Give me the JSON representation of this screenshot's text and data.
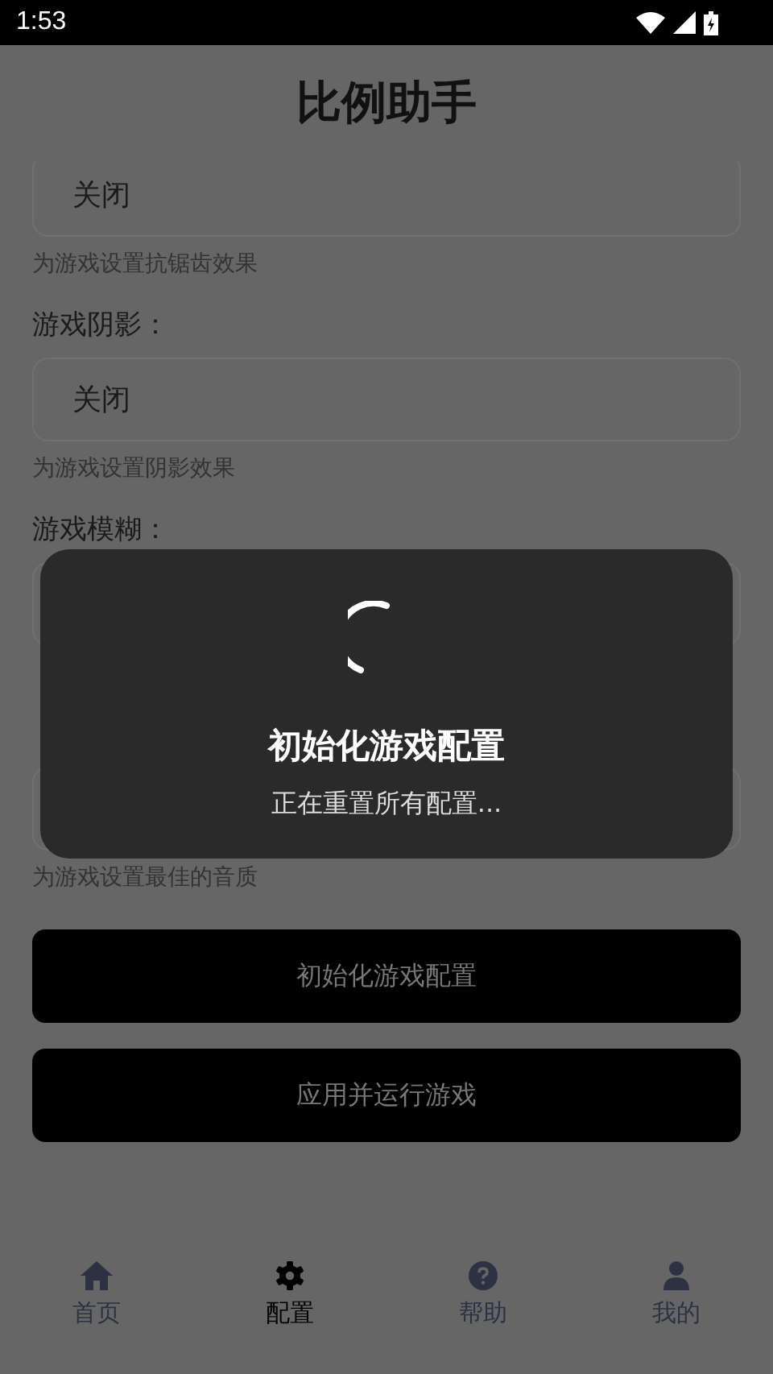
{
  "status_bar": {
    "time": "1:53"
  },
  "header": {
    "title": "比例助手"
  },
  "settings": [
    {
      "value": "关闭",
      "hint": "为游戏设置抗锯齿效果"
    },
    {
      "label": "游戏阴影：",
      "value": "关闭",
      "hint": "为游戏设置阴影效果"
    },
    {
      "label": "游戏模糊："
    },
    {
      "hint": "为游戏设置最佳的音质"
    }
  ],
  "buttons": [
    "初始化游戏配置",
    "应用并运行游戏"
  ],
  "dialog": {
    "title": "初始化游戏配置",
    "message": "正在重置所有配置..."
  },
  "nav": [
    {
      "kind": "home",
      "label": "首页",
      "selected": false
    },
    {
      "kind": "settings",
      "label": "配置",
      "selected": true
    },
    {
      "kind": "help",
      "label": "帮助",
      "selected": false
    },
    {
      "kind": "user",
      "label": "我的",
      "selected": false
    }
  ]
}
